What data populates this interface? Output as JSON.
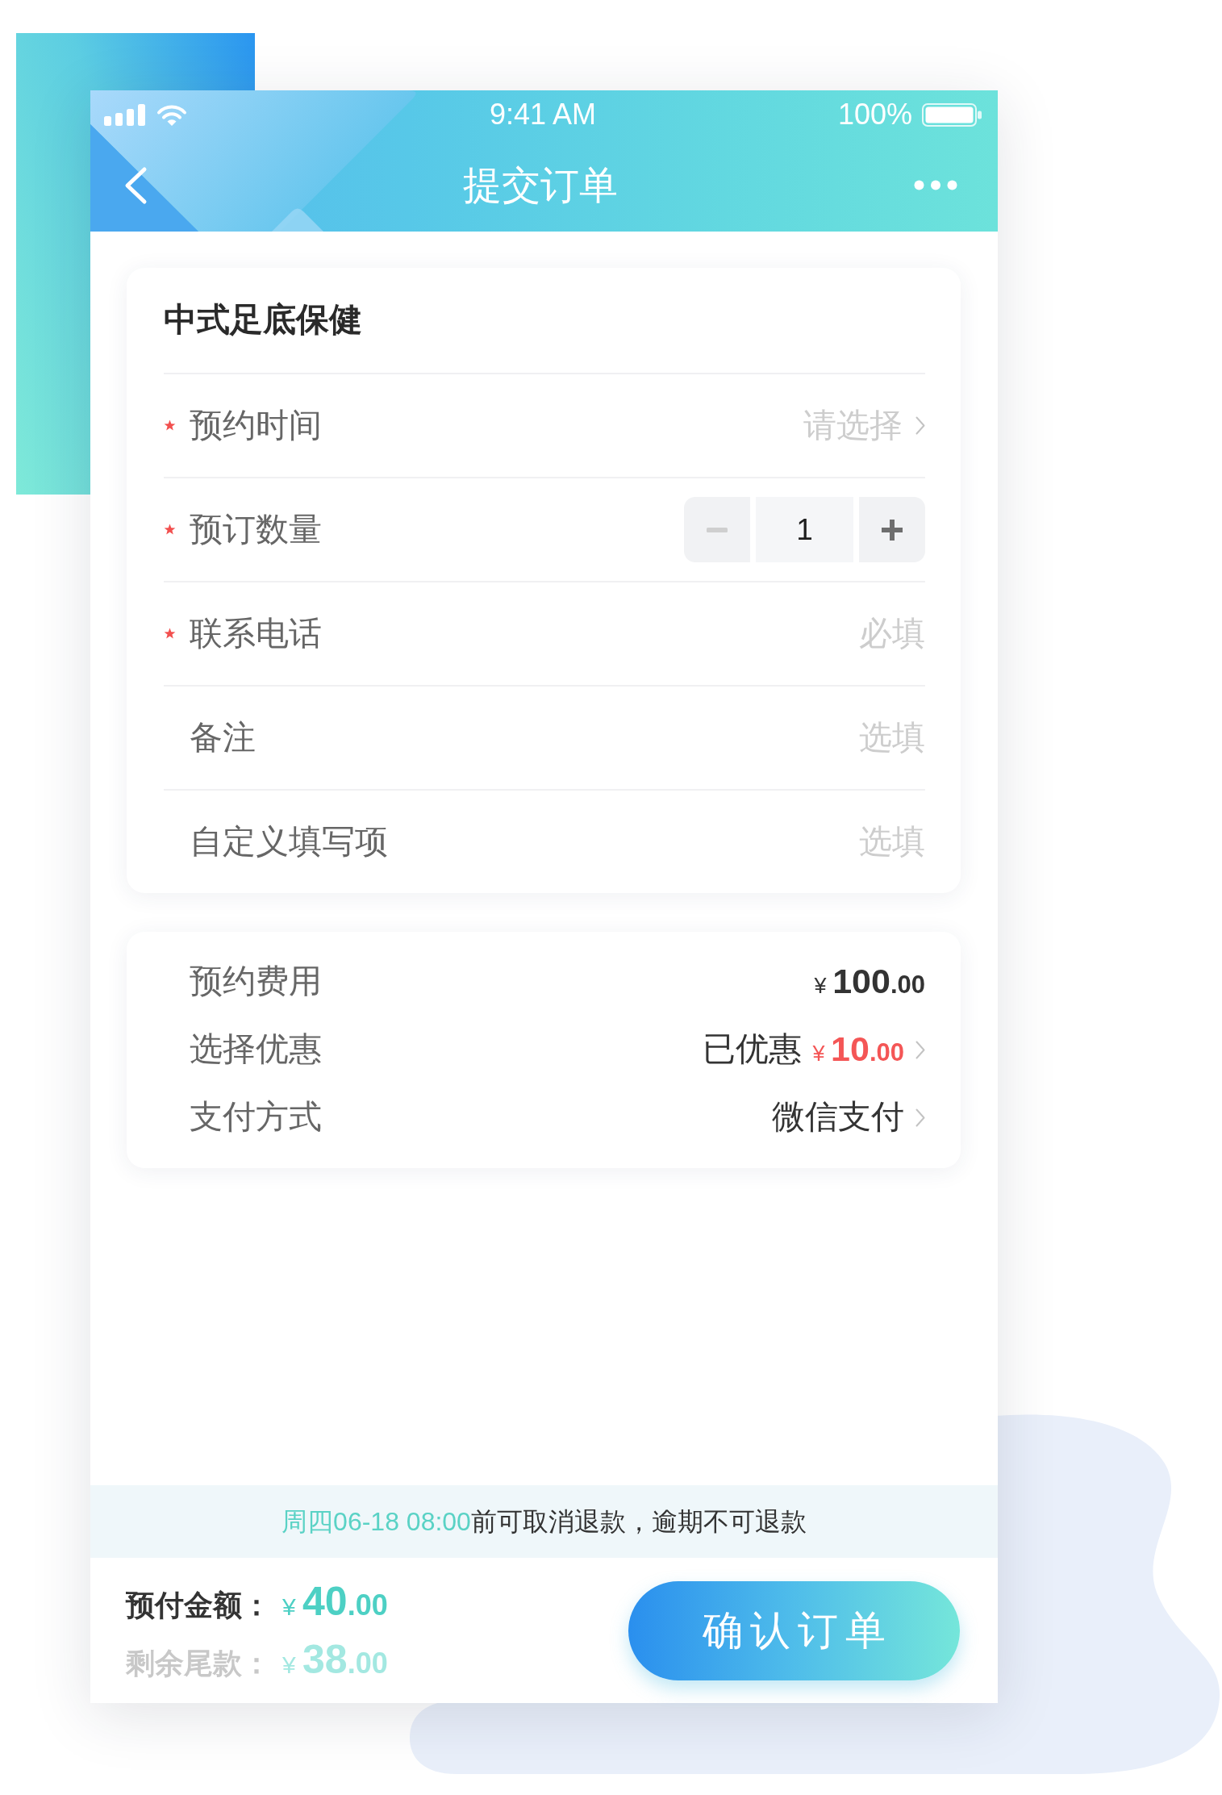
{
  "status_bar": {
    "time": "9:41 AM",
    "battery": "100%"
  },
  "nav_bar": {
    "title": "提交订单"
  },
  "order_card": {
    "title": "中式足底保健",
    "fields": [
      {
        "kind": "select",
        "label": "预约时间",
        "required": true,
        "placeholder": "请选择"
      },
      {
        "kind": "stepper",
        "label": "预订数量",
        "required": true,
        "value": "1",
        "decrease_disabled": true,
        "increase_disabled": false
      },
      {
        "kind": "input",
        "label": "联系电话",
        "required": true,
        "placeholder": "必填"
      },
      {
        "kind": "input",
        "label": "备注",
        "required": false,
        "placeholder": "选填"
      },
      {
        "kind": "input",
        "label": "自定义填写项",
        "required": false,
        "placeholder": "选填"
      }
    ]
  },
  "fee_card": {
    "rows": [
      {
        "kind": "price",
        "label": "预约费用",
        "currency": "¥",
        "whole": "100",
        "cents": ".00",
        "arrow": false
      },
      {
        "kind": "discount",
        "label": "选择优惠",
        "prefix": "已优惠",
        "currency": "¥",
        "whole": "10",
        "cents": ".00",
        "arrow": true
      },
      {
        "kind": "text",
        "label": "支付方式",
        "value": "微信支付",
        "arrow": true
      }
    ]
  },
  "refund_notice": {
    "highlight": "周四06-18 08:00",
    "text": "前可取消退款，逾期不可退款"
  },
  "summary": [
    {
      "kind": "due",
      "label": "预付金额：",
      "currency": "¥",
      "whole": "40",
      "cents": ".00"
    },
    {
      "kind": "remaining",
      "label": "剩余尾款：",
      "currency": "¥",
      "whole": "38",
      "cents": ".00"
    }
  ],
  "submit_button": {
    "label": "确认订单"
  }
}
